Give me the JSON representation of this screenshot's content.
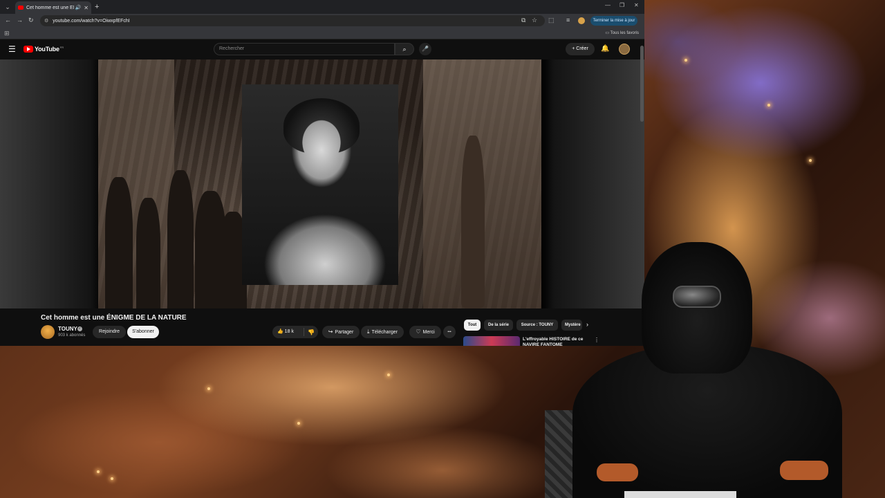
{
  "browser": {
    "tab_title": "Cet homme est une ÉNIGME DE LA NATURE",
    "new_tab": "+",
    "url": "youtube.com/watch?v=OiwxpfEFchI",
    "update_button": "Terminer la mise à jour",
    "all_favorites": "Tous les favoris"
  },
  "youtube": {
    "logo_text": "YouTube",
    "logo_region": "FR",
    "search_placeholder": "Rechercher",
    "create_label": "Créer",
    "video_title": "Cet homme est une ÉNIGME DE LA NATURE",
    "channel": {
      "name": "TOUNY",
      "subscribers": "903 k abonnés"
    },
    "join_label": "Rejoindre",
    "subscribe_label": "S'abonner",
    "like_count": "18 k",
    "share_label": "Partager",
    "download_label": "Télécharger",
    "thanks_label": "Merci",
    "more_label": "•••",
    "chips": [
      "Tout",
      "De la série",
      "Source : TOUNY",
      "Mystère"
    ],
    "recommended": {
      "title": "L'effroyable HISTOIRE de ce NAVIRE FANTOME"
    }
  },
  "icons": {
    "menu": "hamburger-icon",
    "search": "search-icon",
    "mic": "mic-icon",
    "bell": "bell-icon",
    "like": "thumbs-up-icon",
    "dislike": "thumbs-down-icon",
    "share": "share-icon",
    "download": "download-icon",
    "thanks": "heart-dollar-icon"
  },
  "colors": {
    "youtube_red": "#ff0000",
    "background": "#0f0f0f",
    "chip_active": "#f1f1f1"
  }
}
